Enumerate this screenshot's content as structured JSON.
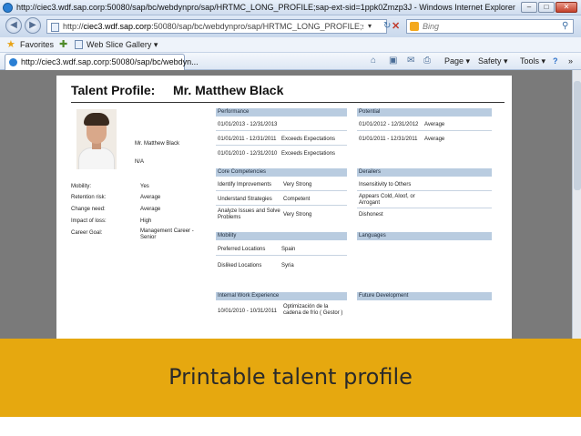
{
  "window": {
    "title": "http://ciec3.wdf.sap.corp:50080/sap/bc/webdynpro/sap/HRTMC_LONG_PROFILE;sap-ext-sid=1ppk0Zmzp3J - Windows Internet Explorer",
    "controls": {
      "minimize": "–",
      "maximize": "□",
      "close": "✕"
    }
  },
  "address_bar": {
    "url_prefix": "http://",
    "url_host": "ciec3.wdf.sap.corp",
    "url_rest": ":50080/sap/bc/webdynpro/sap/HRTMC_LONG_PROFILE;sap-ext-sid=1ppk",
    "search_placeholder": "Bing"
  },
  "favorites_bar": {
    "favorites_label": "Favorites",
    "web_slice_label": "Web Slice Gallery ▾"
  },
  "command_bar": {
    "tab_title": "http://ciec3.wdf.sap.corp:50080/sap/bc/webdyn...",
    "page_label": "Page ▾",
    "safety_label": "Safety ▾",
    "tools_label": "Tools ▾",
    "help_label": "?",
    "more_label": "»"
  },
  "profile": {
    "heading": "Talent Profile:",
    "name": "Mr. Matthew Black",
    "name_small": "Mr. Matthew Black",
    "na": "N/A",
    "fields": [
      {
        "label": "Mobility:",
        "value": "Yes"
      },
      {
        "label": "Retention risk:",
        "value": "Average"
      },
      {
        "label": "Change need:",
        "value": "Average"
      },
      {
        "label": "Impact of loss:",
        "value": "High"
      },
      {
        "label": "Career Goal:",
        "value": "Management Career - Senior"
      }
    ],
    "performance": {
      "title": "Performance",
      "rows": [
        {
          "period": "01/01/2013 - 12/31/2013",
          "rating": ""
        },
        {
          "period": "01/01/2011 - 12/31/2011",
          "rating": "Exceeds Expectations"
        },
        {
          "period": "01/01/2010 - 12/31/2010",
          "rating": "Exceeds Expectations"
        }
      ]
    },
    "potential": {
      "title": "Potential",
      "rows": [
        {
          "period": "01/01/2012 - 12/31/2012",
          "rating": "Average"
        },
        {
          "period": "01/01/2011 - 12/31/2011",
          "rating": "Average"
        }
      ]
    },
    "core_competencies": {
      "title": "Core Competencies",
      "rows": [
        {
          "name": "Identify Improvements",
          "level": "Very Strong"
        },
        {
          "name": "Understand Strategies",
          "level": "Competent"
        },
        {
          "name": "Analyze Issues and Solve Problems",
          "level": "Very Strong"
        }
      ]
    },
    "derailers": {
      "title": "Derailers",
      "items": [
        "Insensitivity to Others",
        "Appears Cold, Aloof, or Arrogant",
        "Dishonest"
      ]
    },
    "mobility": {
      "title": "Mobility",
      "rows": [
        {
          "label": "Preferred Locations",
          "value": "Spain"
        },
        {
          "label": "Disliked Locations",
          "value": "Syria"
        }
      ]
    },
    "languages": {
      "title": "Languages"
    },
    "internal_work": {
      "title": "Internal Work Experience",
      "rows": [
        {
          "period": "10/01/2010 - 10/31/2011",
          "role": "Optimización de la cadena de frío ( Gestor )"
        }
      ]
    },
    "future_development": {
      "title": "Future Development"
    }
  },
  "caption": "Printable talent profile"
}
